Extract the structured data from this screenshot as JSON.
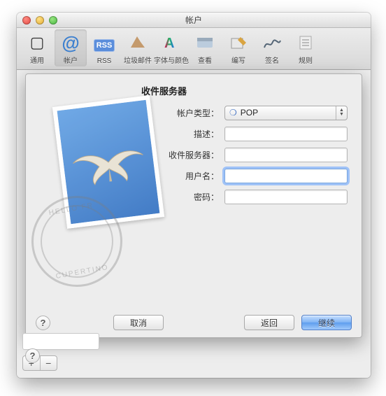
{
  "window": {
    "title": "帐户"
  },
  "toolbar": {
    "items": [
      {
        "label": "通用"
      },
      {
        "label": "帐户"
      },
      {
        "label": "RSS"
      },
      {
        "label": "垃圾邮件"
      },
      {
        "label": "字体与颜色"
      },
      {
        "label": "查看"
      },
      {
        "label": "编写"
      },
      {
        "label": "签名"
      },
      {
        "label": "规则"
      }
    ],
    "rss_badge": "RSS"
  },
  "sheet": {
    "title": "收件服务器",
    "labels": {
      "account_type": "帐户类型：",
      "description": "描述：",
      "incoming_server": "收件服务器：",
      "username": "用户名：",
      "password": "密码："
    },
    "fields": {
      "account_type_value": "POP",
      "description": "",
      "incoming_server": "",
      "username": "",
      "password": ""
    },
    "buttons": {
      "cancel": "取消",
      "back": "返回",
      "continue": "继续"
    },
    "help_glyph": "?",
    "postmark": {
      "top": "HELLO FR",
      "bottom": "CUPERTINO",
      "apple": ""
    }
  },
  "outer": {
    "plus": "+",
    "minus": "−",
    "help_glyph": "?"
  }
}
